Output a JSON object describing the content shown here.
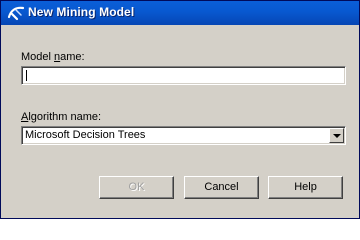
{
  "window": {
    "title": "New Mining Model",
    "icon": "mining-model-icon"
  },
  "model_name": {
    "label_pre": "Model ",
    "label_accel": "n",
    "label_post": "ame:",
    "value": ""
  },
  "algorithm": {
    "label_pre": "",
    "label_accel": "A",
    "label_post": "lgorithm name:",
    "selected": "Microsoft Decision Trees"
  },
  "buttons": {
    "ok": "OK",
    "cancel": "Cancel",
    "help": "Help"
  },
  "colors": {
    "titlebar": "#0858d0",
    "dialog_face": "#d4d0c8",
    "disabled_text": "#a0a0a0"
  }
}
